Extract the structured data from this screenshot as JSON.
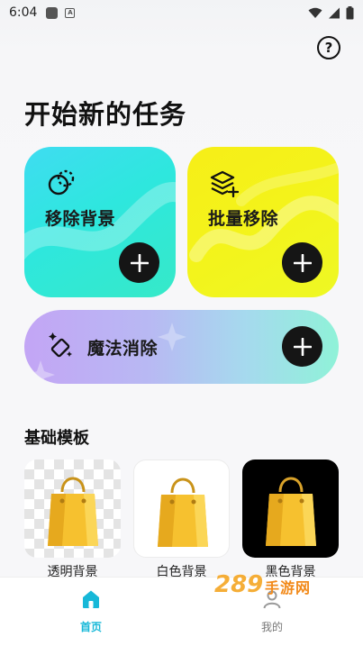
{
  "status_bar": {
    "time": "6:04"
  },
  "header": {
    "help_icon": "question-circle-icon"
  },
  "page_title": "开始新的任务",
  "cards": {
    "remove_bg": {
      "label": "移除背景",
      "icon": "bubbles-icon",
      "action_icon": "plus-icon"
    },
    "batch_remove": {
      "label": "批量移除",
      "icon": "layers-plus-icon",
      "action_icon": "plus-icon"
    },
    "magic_erase": {
      "label": "魔法消除",
      "icon": "magic-eraser-icon",
      "action_icon": "plus-icon"
    }
  },
  "templates_section": {
    "title": "基础模板",
    "items": [
      {
        "label": "透明背景",
        "background": "transparent"
      },
      {
        "label": "白色背景",
        "background": "#ffffff"
      },
      {
        "label": "黑色背景",
        "background": "#000000"
      }
    ]
  },
  "bottom_nav": {
    "items": [
      {
        "label": "首页",
        "icon": "home-icon",
        "active": true
      },
      {
        "label": "我的",
        "icon": "user-icon",
        "active": false
      }
    ]
  },
  "watermark": {
    "number": "289",
    "text": "手游网"
  },
  "colors": {
    "accent": "#17b8d8",
    "remove_bg_card": "#2ee7de",
    "batch_card": "#f4f31a",
    "plus_button": "#151515"
  }
}
